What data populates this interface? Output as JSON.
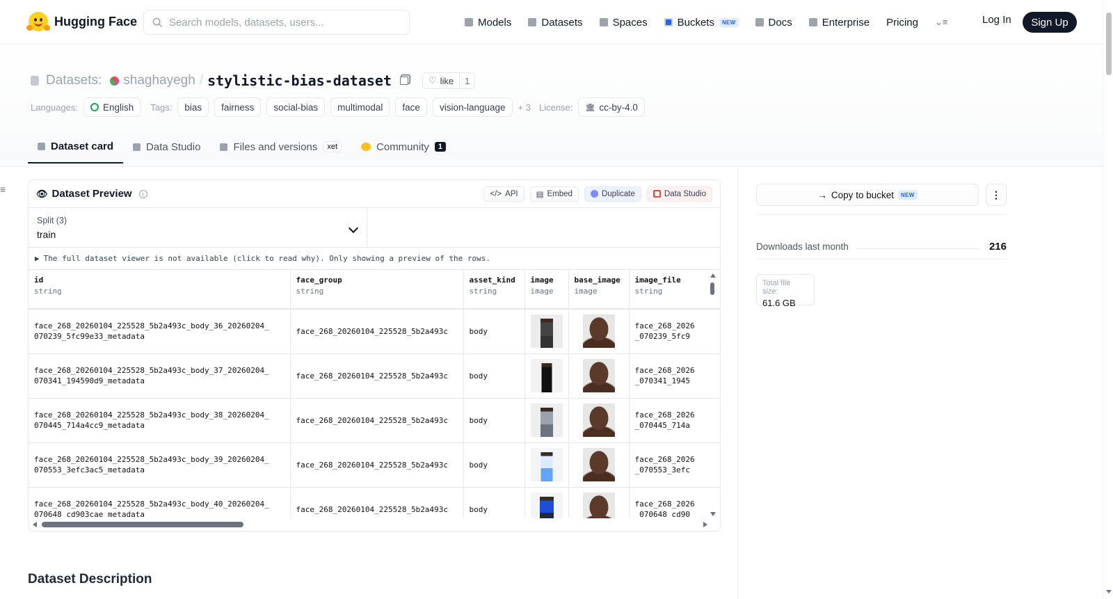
{
  "nav": {
    "brand": "Hugging Face",
    "search_placeholder": "Search models, datasets, users...",
    "links": [
      "Models",
      "Datasets",
      "Spaces",
      "Buckets",
      "Docs",
      "Enterprise",
      "Pricing"
    ],
    "buckets_badge": "NEW",
    "login": "Log In",
    "signup": "Sign Up"
  },
  "header": {
    "section": "Datasets:",
    "owner": "shaghayegh",
    "separator": "/",
    "repo": "stylistic-bias-dataset",
    "like_label": "like",
    "like_count": "1",
    "languages_label": "Languages:",
    "language": "English",
    "tags_label": "Tags:",
    "tags": [
      "bias",
      "fairness",
      "social-bias",
      "multimodal",
      "face",
      "vision-language"
    ],
    "more_tags": "+ 3",
    "license_label": "License:",
    "license": "cc-by-4.0"
  },
  "tabs": {
    "dataset_card": "Dataset card",
    "data_studio": "Data Studio",
    "files": "Files and versions",
    "xet": "xet",
    "community": "Community",
    "community_count": "1"
  },
  "preview": {
    "title": "Dataset Preview",
    "info": "i",
    "actions": {
      "api": "API",
      "embed": "Embed",
      "duplicate": "Duplicate",
      "studio": "Data Studio"
    },
    "split_label": "Split (3)",
    "split_value": "train",
    "notice": "The full dataset viewer is not available (click to read why). Only showing a preview of the rows.",
    "columns": [
      {
        "name": "id",
        "type": "string"
      },
      {
        "name": "face_group",
        "type": "string"
      },
      {
        "name": "asset_kind",
        "type": "string"
      },
      {
        "name": "image",
        "type": "image"
      },
      {
        "name": "base_image",
        "type": "image"
      },
      {
        "name": "image_file",
        "type": "string"
      }
    ],
    "rows": [
      {
        "id": "face_268_20260104_225528_5b2a493c_body_36_20260204_\n070239_5fc99e33_metadata",
        "face_group": "face_268_20260104_225528_5b2a493c",
        "asset_kind": "body",
        "image_file": "face_268_2026\n_070239_5fc9"
      },
      {
        "id": "face_268_20260104_225528_5b2a493c_body_37_20260204_\n070341_194590d9_metadata",
        "face_group": "face_268_20260104_225528_5b2a493c",
        "asset_kind": "body",
        "image_file": "face_268_2026\n_070341_1945"
      },
      {
        "id": "face_268_20260104_225528_5b2a493c_body_38_20260204_\n070445_714a4cc9_metadata",
        "face_group": "face_268_20260104_225528_5b2a493c",
        "asset_kind": "body",
        "image_file": "face_268_2026\n_070445_714a"
      },
      {
        "id": "face_268_20260104_225528_5b2a493c_body_39_20260204_\n070553_3efc3ac5_metadata",
        "face_group": "face_268_20260104_225528_5b2a493c",
        "asset_kind": "body",
        "image_file": "face_268_2026\n_070553_3efc"
      },
      {
        "id": "face_268_20260104_225528_5b2a493c_body_40_20260204_\n070648_cd903cae_metadata",
        "face_group": "face_268_20260104_225528_5b2a493c",
        "asset_kind": "body",
        "image_file": "face_268_2026\n_070648_cd90"
      }
    ],
    "description_heading": "Dataset Description"
  },
  "sidebar": {
    "copy_bucket": "Copy to bucket",
    "copy_bucket_badge": "NEW",
    "kebab": "⋮",
    "downloads_label": "Downloads last month",
    "downloads_value": "216",
    "size_label": "Total file size:",
    "size_value": "61.6 GB"
  },
  "colors": {
    "accent": "#111827",
    "brand_yellow": "#ffd21e",
    "link_blue": "#2563eb"
  },
  "icons": [
    "search-icon",
    "database-icon",
    "copy-icon",
    "heart-icon",
    "globe-icon",
    "bank-icon",
    "eye-icon",
    "info-icon",
    "chevron-down-icon",
    "arrow-right-icon",
    "kebab-icon"
  ]
}
